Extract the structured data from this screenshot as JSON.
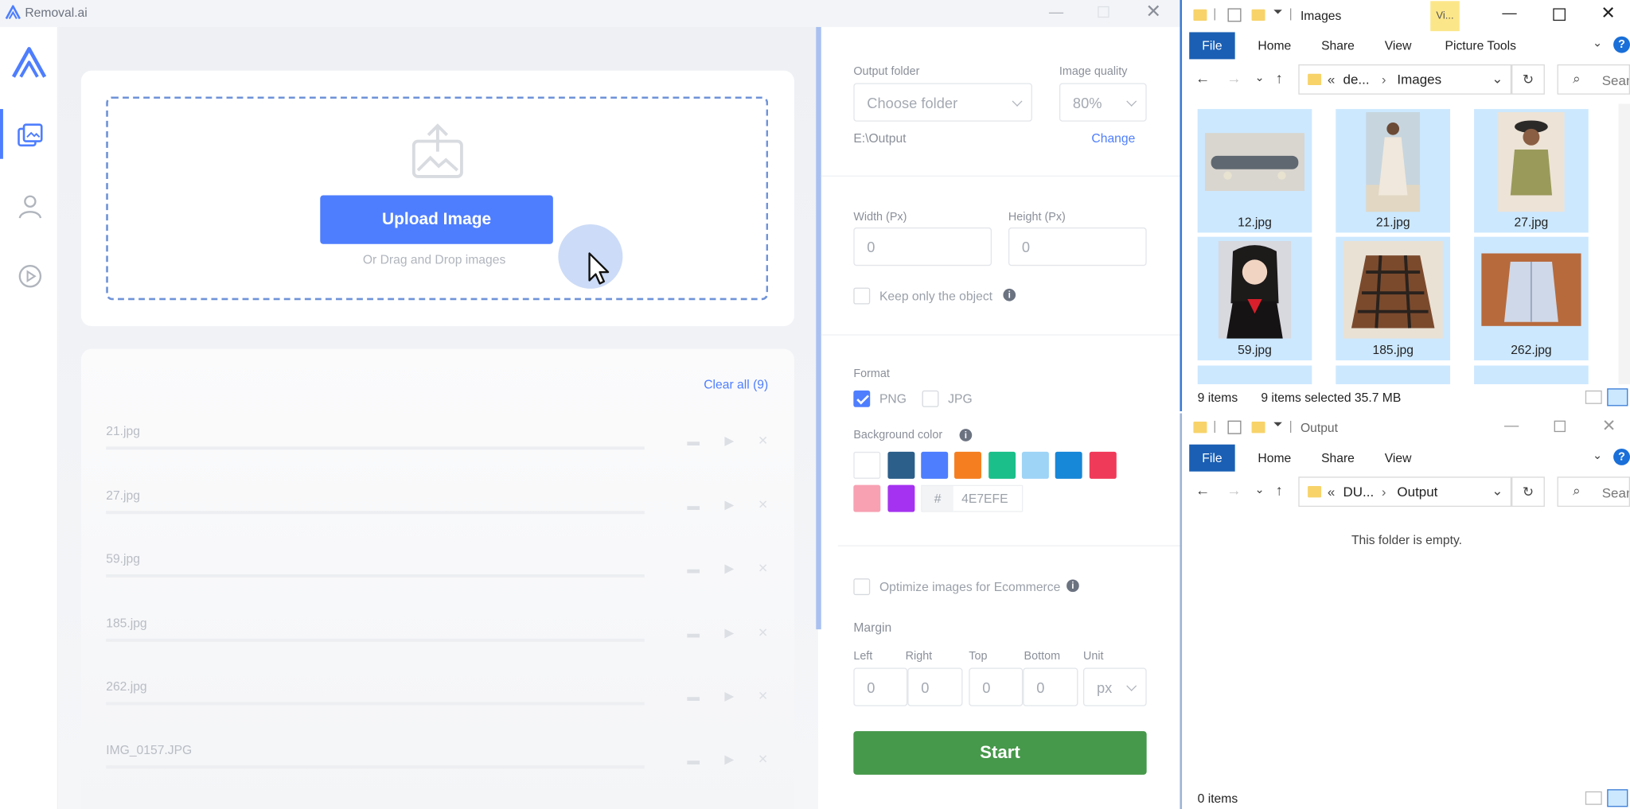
{
  "app": {
    "title": "Removal.ai",
    "upload_label": "Upload Image",
    "drag_hint": "Or Drag and Drop images",
    "clear_all": "Clear all (9)",
    "files": [
      "21.jpg",
      "27.jpg",
      "59.jpg",
      "185.jpg",
      "262.jpg",
      "IMG_0157.JPG"
    ],
    "settings": {
      "output_folder_label": "Output folder",
      "output_folder_value": "Choose folder",
      "output_path": "E:\\Output",
      "quality_label": "Image quality",
      "quality_value": "80%",
      "change_label": "Change",
      "width_label": "Width (Px)",
      "width_value": "0",
      "height_label": "Height (Px)",
      "height_value": "0",
      "keep_object_label": "Keep only the object",
      "format_label": "Format",
      "format_png": "PNG",
      "format_jpg": "JPG",
      "bg_color_label": "Background color",
      "hash": "#",
      "hex_value": "4E7EFE",
      "optimize_label": "Optimize images for Ecommerce",
      "margin_label": "Margin",
      "margin_left_label": "Left",
      "margin_right_label": "Right",
      "margin_top_label": "Top",
      "margin_bottom_label": "Bottom",
      "margin_unit_label": "Unit",
      "margin_left": "0",
      "margin_right": "0",
      "margin_top": "0",
      "margin_bottom": "0",
      "margin_unit": "px",
      "start_label": "Start",
      "swatches": [
        "#ffffff",
        "#2c5f8a",
        "#4e7efe",
        "#f57f20",
        "#1bbf8a",
        "#9ed4f6",
        "#1787d8",
        "#f03a5a",
        "#f7a1b3",
        "#a532f0"
      ]
    }
  },
  "explorer_images": {
    "title": "Images",
    "context_tab": "Vi...",
    "ribbon": {
      "file": "File",
      "home": "Home",
      "share": "Share",
      "view": "View",
      "picture_tools": "Picture Tools"
    },
    "breadcrumb_prefix": "«",
    "breadcrumb_parent": "de...",
    "breadcrumb_current": "Images",
    "search_placeholder": "Search",
    "thumbnails": [
      "12.jpg",
      "21.jpg",
      "27.jpg",
      "59.jpg",
      "185.jpg",
      "262.jpg"
    ],
    "status_count": "9 items",
    "status_selected": "9 items selected  35.7 MB"
  },
  "explorer_output": {
    "title": "Output",
    "ribbon": {
      "file": "File",
      "home": "Home",
      "share": "Share",
      "view": "View"
    },
    "breadcrumb_prefix": "«",
    "breadcrumb_parent": "DU...",
    "breadcrumb_current": "Output",
    "search_placeholder": "Search",
    "empty_message": "This folder is empty.",
    "status_count": "0 items"
  },
  "colors": {
    "accent": "#4e7efe",
    "start": "#46984a",
    "explorer_file_tab": "#1a5fb4",
    "selection": "#cce8ff"
  }
}
